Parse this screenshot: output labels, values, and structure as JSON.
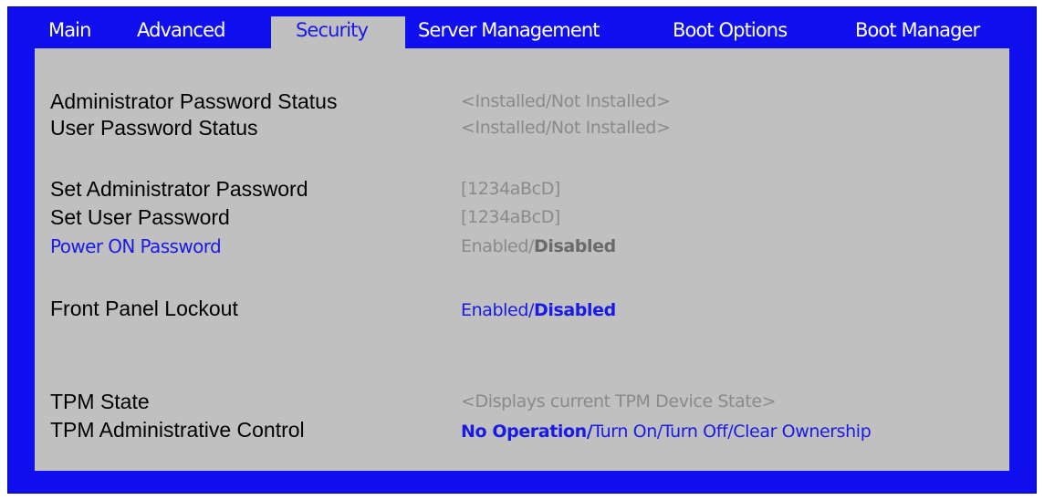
{
  "tabs": [
    {
      "label": "Main"
    },
    {
      "label": "Advanced"
    },
    {
      "label": "Security"
    },
    {
      "label": "Server Management"
    },
    {
      "label": "Boot Options"
    },
    {
      "label": "Boot Manager"
    }
  ],
  "active_tab": "Security",
  "settings": {
    "admin_password_status": {
      "label": "Administrator Password Status",
      "value": "<Installed/Not Installed>"
    },
    "user_password_status": {
      "label": "User Password Status",
      "value": "<Installed/Not Installed>"
    },
    "set_admin_password": {
      "label": "Set Administrator Password",
      "value": "[1234aBcD]"
    },
    "set_user_password": {
      "label": "Set User Password",
      "value": "[1234aBcD]"
    },
    "power_on_password": {
      "label": "Power ON Password",
      "option_a": "Enabled/",
      "option_selected": "Disabled"
    },
    "front_panel_lockout": {
      "label": "Front Panel Lockout",
      "option_a": "Enabled/",
      "option_selected": "Disabled"
    },
    "tpm_state": {
      "label": "TPM State",
      "value": "<Displays current TPM Device State>"
    },
    "tpm_admin_control": {
      "label": "TPM Administrative Control",
      "option_selected": "No Operation/",
      "option_rest": "Turn On/Turn Off/Clear Ownership"
    }
  },
  "colors": {
    "frame": "#1010ee",
    "panel": "#c0c0c0",
    "highlight": "#1a1ae6",
    "disabled_text": "#8a8a8a"
  }
}
